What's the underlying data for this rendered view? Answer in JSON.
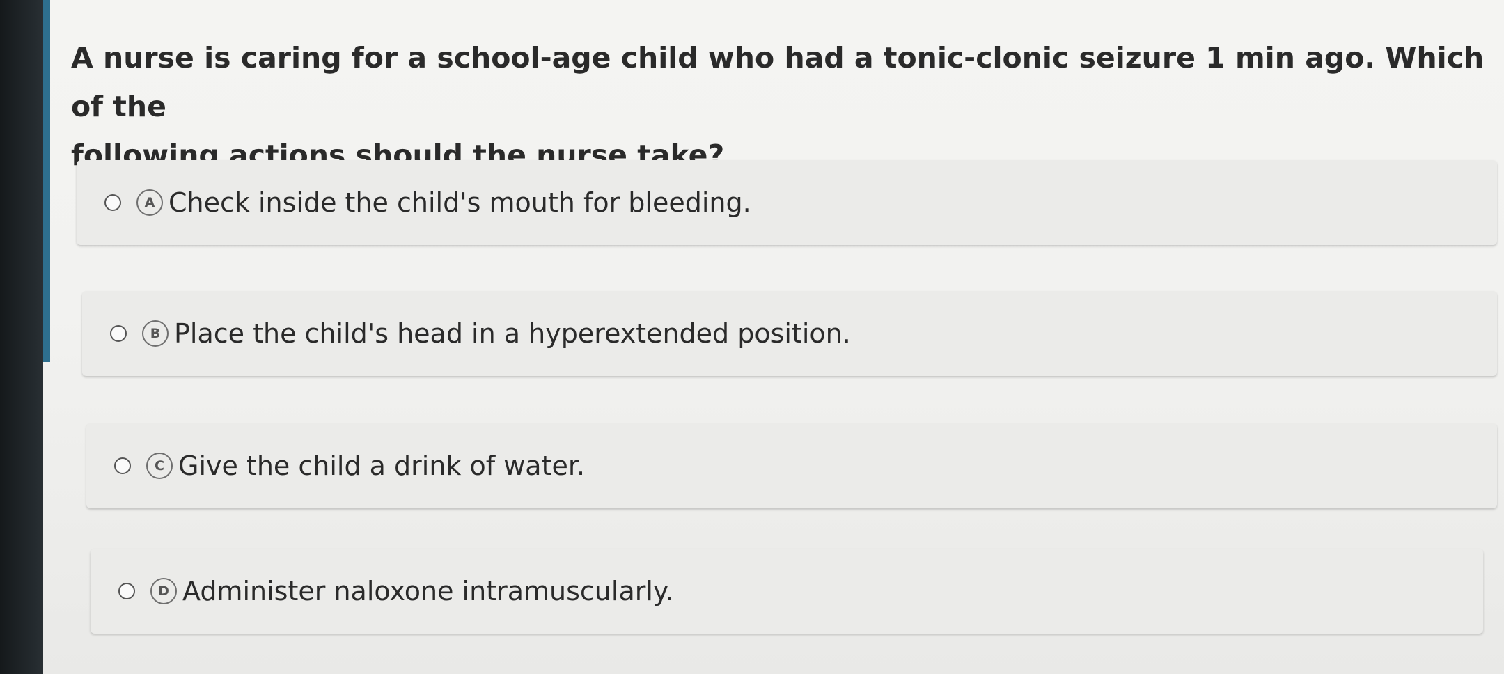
{
  "question": {
    "text": "A nurse is caring for a school-age child who had a tonic-clonic seizure 1 min ago. Which of the\nfollowing actions should the nurse take?"
  },
  "options": [
    {
      "letter": "A",
      "text": "Check inside the child's mouth for bleeding."
    },
    {
      "letter": "B",
      "text": "Place the child's head in a hyperextended position."
    },
    {
      "letter": "C",
      "text": "Give the child a drink of water."
    },
    {
      "letter": "D",
      "text": "Administer naloxone intramuscularly."
    }
  ],
  "colors": {
    "accent_bar": "#2e6f8e",
    "card_background": "#ebebe9",
    "text": "#2a2a2a"
  }
}
